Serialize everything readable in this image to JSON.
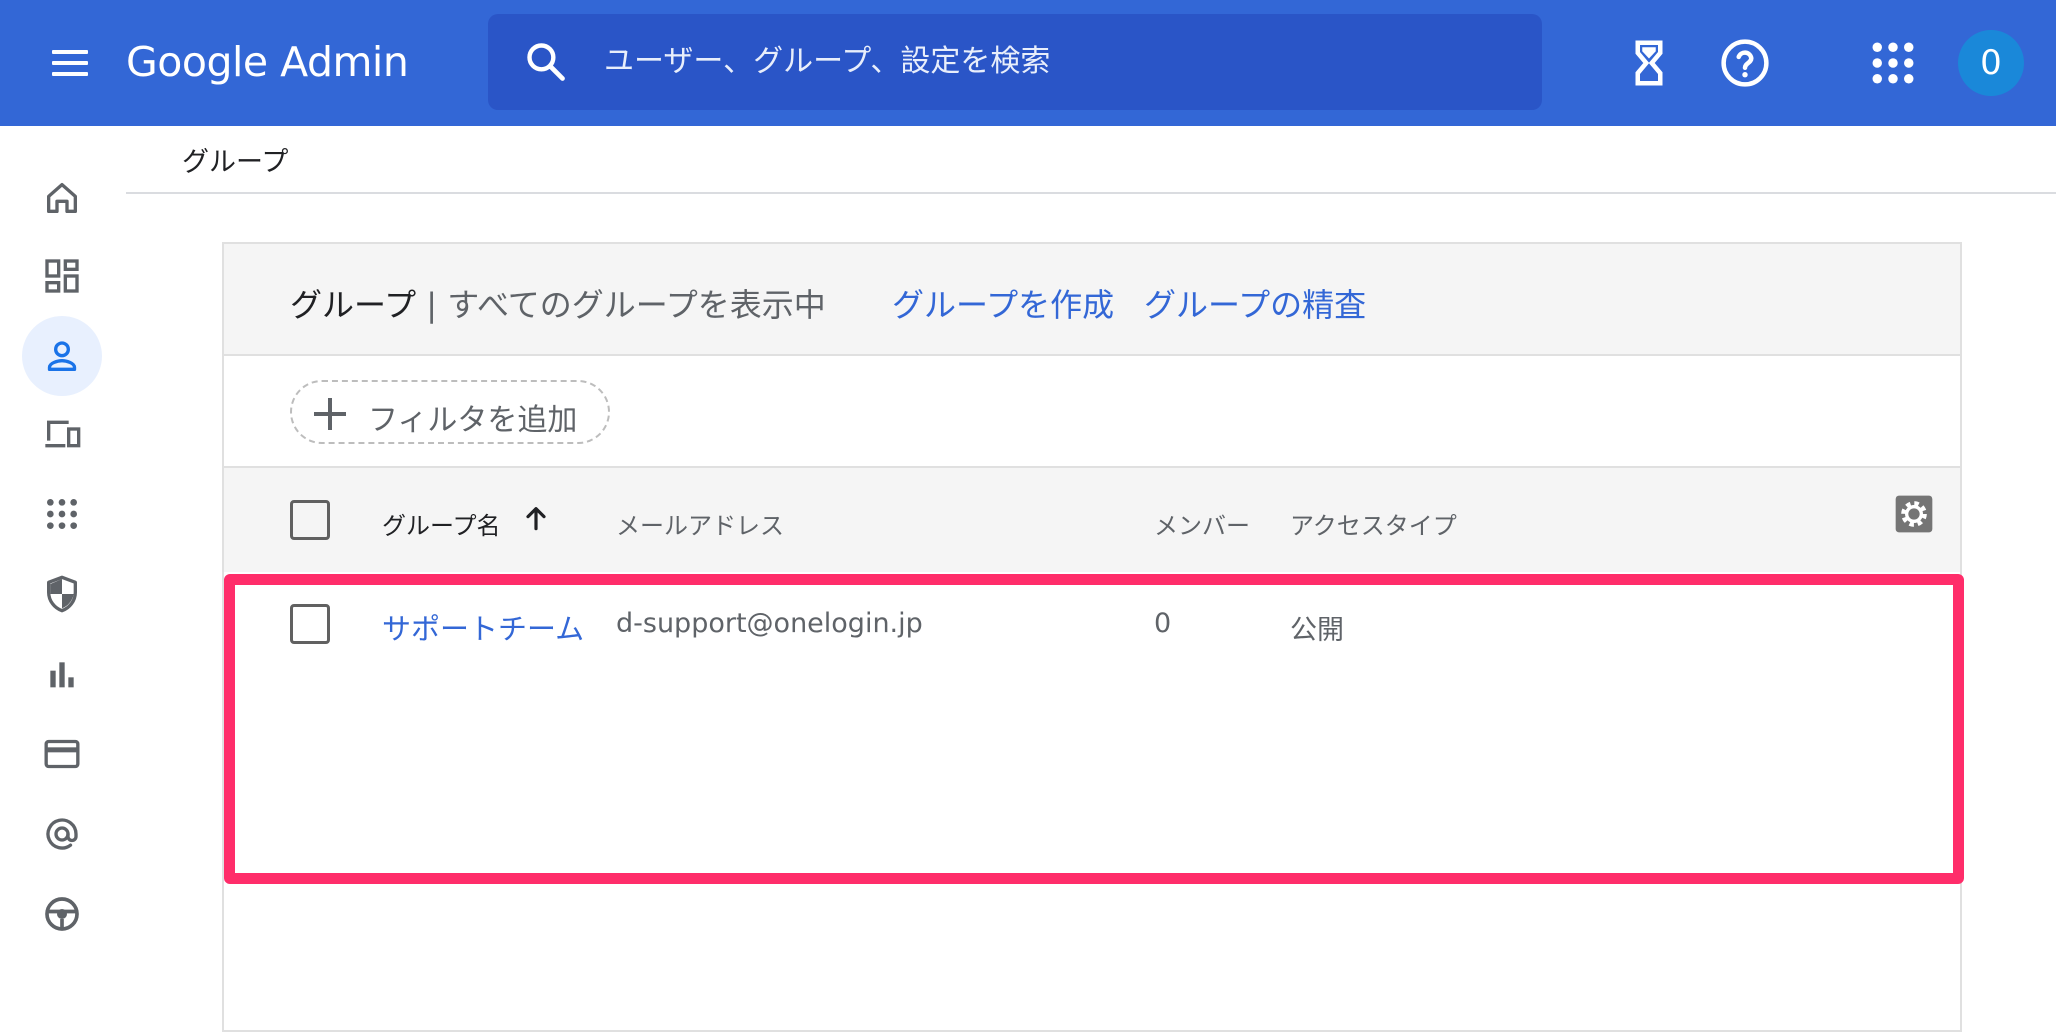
{
  "app": {
    "brand_google": "Google",
    "brand_admin": "Admin"
  },
  "search": {
    "placeholder": "ユーザー、グループ、設定を検索"
  },
  "account": {
    "avatar_letter": "0"
  },
  "sidebar": {
    "items": [
      {
        "icon": "home-icon",
        "active": false
      },
      {
        "icon": "dashboard-icon",
        "active": false
      },
      {
        "icon": "user-icon",
        "active": true
      },
      {
        "icon": "devices-icon",
        "active": false
      },
      {
        "icon": "apps-icon",
        "active": false
      },
      {
        "icon": "security-shield-icon",
        "active": false
      },
      {
        "icon": "reports-icon",
        "active": false
      },
      {
        "icon": "billing-icon",
        "active": false
      },
      {
        "icon": "account-at-icon",
        "active": false
      },
      {
        "icon": "rules-icon",
        "active": false
      }
    ]
  },
  "breadcrumb": {
    "current": "グループ"
  },
  "card": {
    "title_main": "グループ",
    "title_sub": " | すべてのグループを表示中",
    "create_link": "グループを作成",
    "inspect_link": "グループの精査",
    "filter_label": "フィルタを追加"
  },
  "table": {
    "columns": {
      "name": "グループ名",
      "email": "メールアドレス",
      "members": "メンバー",
      "access_type": "アクセスタイプ"
    },
    "rows": [
      {
        "name": "サポートチーム",
        "email": "d-support@onelogin.jp",
        "members": "0",
        "access_type": "公開"
      }
    ]
  },
  "colors": {
    "topbar": "#3367d6",
    "search_bg": "#2a55c7",
    "link": "#3367d6",
    "highlight": "#ff2d6a",
    "avatar": "#1a88d9"
  }
}
